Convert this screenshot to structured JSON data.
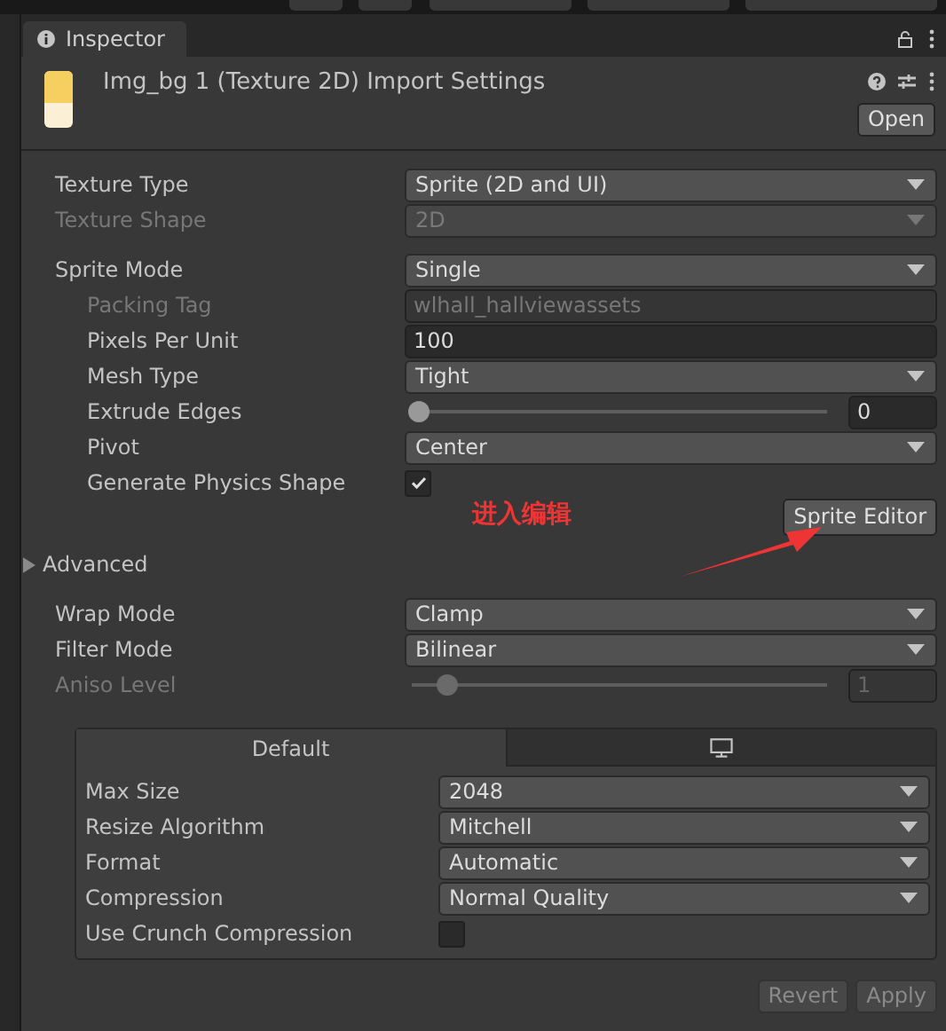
{
  "tab": {
    "label": "Inspector"
  },
  "header": {
    "title": "Img_bg 1 (Texture 2D) Import Settings",
    "open_button": "Open"
  },
  "texture": [
    {
      "kind": "dropdown",
      "label": "Texture Type",
      "value": "Sprite (2D and UI)",
      "disabled": false
    },
    {
      "kind": "dropdown",
      "label": "Texture Shape",
      "value": "2D",
      "disabled": true
    }
  ],
  "sprite_mode": {
    "kind": "dropdown",
    "label": "Sprite Mode",
    "value": "Single",
    "disabled": false,
    "children": [
      {
        "kind": "text",
        "label": "Packing Tag",
        "value": "wlhall_hallviewassets",
        "disabled": true
      },
      {
        "kind": "number",
        "label": "Pixels Per Unit",
        "value": "100",
        "disabled": false
      },
      {
        "kind": "dropdown",
        "label": "Mesh Type",
        "value": "Tight",
        "disabled": false
      },
      {
        "kind": "slider",
        "label": "Extrude Edges",
        "value": "0",
        "level": 0,
        "disabled": false
      },
      {
        "kind": "dropdown",
        "label": "Pivot",
        "value": "Center",
        "disabled": false
      },
      {
        "kind": "checkbox",
        "label": "Generate Physics Shape",
        "checked": true,
        "disabled": false
      }
    ]
  },
  "annotation": "进入编辑",
  "sprite_editor_button": "Sprite Editor",
  "advanced": {
    "label": "Advanced",
    "expanded": false
  },
  "sampling": [
    {
      "kind": "dropdown",
      "label": "Wrap Mode",
      "value": "Clamp",
      "disabled": false
    },
    {
      "kind": "dropdown",
      "label": "Filter Mode",
      "value": "Bilinear",
      "disabled": false
    },
    {
      "kind": "slider",
      "label": "Aniso Level",
      "value": "1",
      "level": 0.07,
      "disabled": true
    }
  ],
  "platform": {
    "tabs": [
      {
        "kind": "text",
        "label": "Default",
        "selected": true
      },
      {
        "kind": "monitor",
        "selected": false
      }
    ],
    "rows": [
      {
        "kind": "dropdown",
        "label": "Max Size",
        "value": "2048"
      },
      {
        "kind": "dropdown",
        "label": "Resize Algorithm",
        "value": "Mitchell"
      },
      {
        "kind": "dropdown",
        "label": "Format",
        "value": "Automatic"
      },
      {
        "kind": "dropdown",
        "label": "Compression",
        "value": "Normal Quality"
      },
      {
        "kind": "checkbox",
        "label": "Use Crunch Compression",
        "checked": false
      }
    ]
  },
  "buttons": [
    {
      "label": "Revert",
      "disabled": true
    },
    {
      "label": "Apply",
      "disabled": true
    }
  ]
}
